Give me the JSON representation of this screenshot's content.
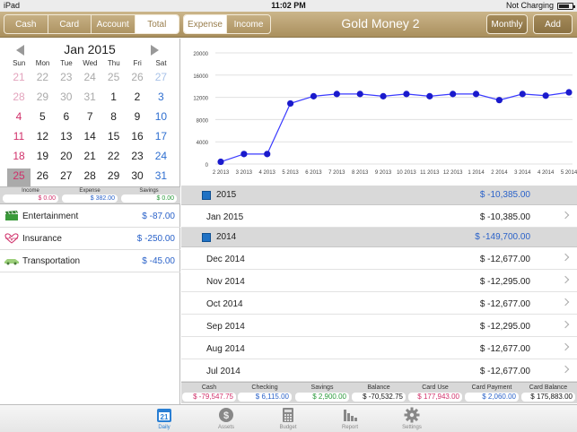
{
  "status_bar": {
    "device": "iPad",
    "time": "11:02 PM",
    "battery": "Not Charging"
  },
  "header": {
    "account_tabs": [
      {
        "label": "Cash",
        "active": false
      },
      {
        "label": "Card",
        "active": false
      },
      {
        "label": "Account",
        "active": false
      },
      {
        "label": "Total",
        "active": true
      }
    ],
    "type_tabs": [
      {
        "label": "Expense",
        "active": true
      },
      {
        "label": "Income",
        "active": false
      }
    ],
    "title": "Gold Money 2",
    "monthly_label": "Monthly",
    "add_label": "Add"
  },
  "calendar": {
    "month_title": "Jan 2015",
    "weekdays": [
      "Sun",
      "Mon",
      "Tue",
      "Wed",
      "Thu",
      "Fri",
      "Sat"
    ],
    "weeks": [
      [
        {
          "d": "21",
          "o": true
        },
        {
          "d": "22",
          "o": true
        },
        {
          "d": "23",
          "o": true
        },
        {
          "d": "24",
          "o": true
        },
        {
          "d": "25",
          "o": true
        },
        {
          "d": "26",
          "o": true
        },
        {
          "d": "27",
          "o": true
        }
      ],
      [
        {
          "d": "28",
          "o": true,
          "dot": true
        },
        {
          "d": "29",
          "o": true
        },
        {
          "d": "30",
          "o": true
        },
        {
          "d": "31",
          "o": true,
          "dot": true
        },
        {
          "d": "1"
        },
        {
          "d": "2"
        },
        {
          "d": "3",
          "dot": true
        }
      ],
      [
        {
          "d": "4",
          "dot": true
        },
        {
          "d": "5"
        },
        {
          "d": "6"
        },
        {
          "d": "7",
          "dot": true
        },
        {
          "d": "8",
          "dot": true
        },
        {
          "d": "9",
          "dot": true
        },
        {
          "d": "10",
          "dot": true
        }
      ],
      [
        {
          "d": "11",
          "dot": true
        },
        {
          "d": "12",
          "dot": true
        },
        {
          "d": "13"
        },
        {
          "d": "14",
          "dot": true
        },
        {
          "d": "15"
        },
        {
          "d": "16",
          "dot": true
        },
        {
          "d": "17",
          "dot": true
        }
      ],
      [
        {
          "d": "18",
          "dot": true
        },
        {
          "d": "19",
          "dot": true
        },
        {
          "d": "20"
        },
        {
          "d": "21",
          "dot": true
        },
        {
          "d": "22",
          "dot": true
        },
        {
          "d": "23",
          "dot": true
        },
        {
          "d": "24",
          "dot": true
        }
      ],
      [
        {
          "d": "25",
          "today": true
        },
        {
          "d": "26"
        },
        {
          "d": "27"
        },
        {
          "d": "28"
        },
        {
          "d": "29"
        },
        {
          "d": "30"
        },
        {
          "d": "31"
        }
      ]
    ]
  },
  "day_summary": {
    "income": {
      "label": "Income",
      "value": "$ 0.00",
      "color": "#d0306a"
    },
    "expense": {
      "label": "Expense",
      "value": "$ 382.00",
      "color": "#2a62c9"
    },
    "savings": {
      "label": "Savings",
      "value": "$ 0.00",
      "color": "#2a9a3a"
    }
  },
  "categories": [
    {
      "name": "Entertainment",
      "amount": "$ -87.00",
      "icon": "clapperboard-icon"
    },
    {
      "name": "Insurance",
      "amount": "$ -250.00",
      "icon": "heart-pulse-icon"
    },
    {
      "name": "Transportation",
      "amount": "$ -45.00",
      "icon": "car-icon"
    }
  ],
  "chart_data": {
    "type": "line",
    "x": [
      "2 2013",
      "3 2013",
      "4 2013",
      "5 2013",
      "6 2013",
      "7 2013",
      "8 2013",
      "9 2013",
      "10 2013",
      "11 2013",
      "12 2013",
      "1 2014",
      "2 2014",
      "3 2014",
      "4 2014",
      "5 2014"
    ],
    "values": [
      400,
      1800,
      1800,
      10900,
      12200,
      12600,
      12600,
      12200,
      12600,
      12200,
      12600,
      12600,
      11500,
      12600,
      12300,
      12900
    ],
    "y_ticks": [
      "0",
      "4000",
      "8000",
      "12000",
      "16000",
      "20000"
    ],
    "ylim": [
      0,
      20000
    ],
    "grid": "horizontal",
    "line_color": "#3a3aff",
    "point_color": "#1a1acc"
  },
  "monthly_list": [
    {
      "type": "group",
      "label": "2015",
      "amount": "$ -10,385.00"
    },
    {
      "type": "item",
      "label": "Jan 2015",
      "amount": "$ -10,385.00"
    },
    {
      "type": "group",
      "label": "2014",
      "amount": "$ -149,700.00"
    },
    {
      "type": "item",
      "label": "Dec 2014",
      "amount": "$ -12,677.00"
    },
    {
      "type": "item",
      "label": "Nov 2014",
      "amount": "$ -12,295.00"
    },
    {
      "type": "item",
      "label": "Oct 2014",
      "amount": "$ -12,677.00"
    },
    {
      "type": "item",
      "label": "Sep 2014",
      "amount": "$ -12,295.00"
    },
    {
      "type": "item",
      "label": "Aug 2014",
      "amount": "$ -12,677.00"
    },
    {
      "type": "item",
      "label": "Jul 2014",
      "amount": "$ -12,677.00"
    }
  ],
  "balances": [
    {
      "label": "Cash",
      "value": "$ -79,547.75",
      "color": "#d0306a"
    },
    {
      "label": "Checking",
      "value": "$ 6,115.00",
      "color": "#2a62c9"
    },
    {
      "label": "Savings",
      "value": "$ 2,900.00",
      "color": "#2a9a3a"
    },
    {
      "label": "Balance",
      "value": "$ -70,532.75",
      "color": "#111111"
    },
    {
      "label": "Card Use",
      "value": "$ 177,943.00",
      "color": "#d0306a"
    },
    {
      "label": "Card Payment",
      "value": "$ 2,060.00",
      "color": "#2a62c9"
    },
    {
      "label": "Card Balance",
      "value": "$ 175,883.00",
      "color": "#111111"
    }
  ],
  "tabbar": [
    {
      "label": "Daily",
      "icon": "calendar-icon",
      "active": true
    },
    {
      "label": "Assets",
      "icon": "dollar-coin-icon",
      "active": false
    },
    {
      "label": "Budget",
      "icon": "calculator-icon",
      "active": false
    },
    {
      "label": "Report",
      "icon": "bar-chart-icon",
      "active": false
    },
    {
      "label": "Settings",
      "icon": "gear-icon",
      "active": false
    }
  ]
}
